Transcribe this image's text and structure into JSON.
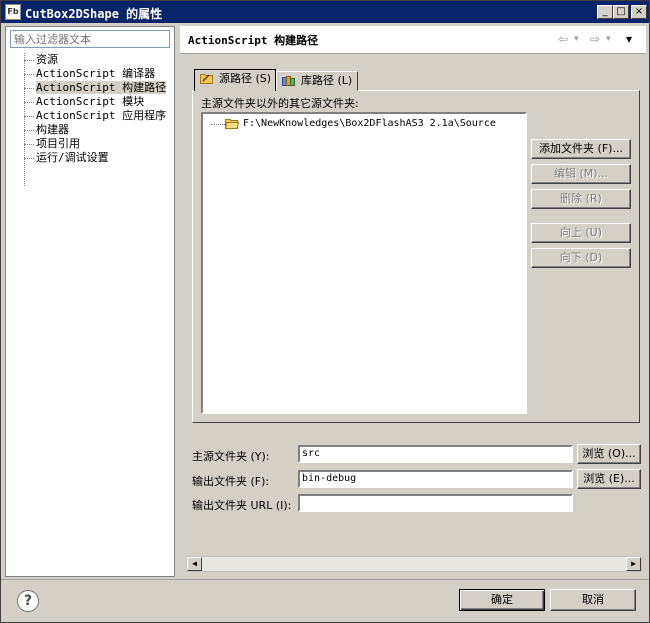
{
  "window": {
    "icon_text": "Fb",
    "title": "CutBox2DShape 的属性",
    "minimize": "_",
    "maximize": "□",
    "close": "×"
  },
  "left": {
    "filter_placeholder": "输入过滤器文本",
    "tree": [
      {
        "label": "资源",
        "selected": false
      },
      {
        "label": "ActionScript 编译器",
        "selected": false
      },
      {
        "label": "ActionScript 构建路径",
        "selected": true
      },
      {
        "label": "ActionScript 模块",
        "selected": false
      },
      {
        "label": "ActionScript 应用程序",
        "selected": false
      },
      {
        "label": "构建器",
        "selected": false
      },
      {
        "label": "项目引用",
        "selected": false
      },
      {
        "label": "运行/调试设置",
        "selected": false
      }
    ]
  },
  "right": {
    "title": "ActionScript 构建路径",
    "nav": {
      "back": "⇦",
      "back_menu": "▾",
      "forward": "⇨",
      "forward_menu": "▾",
      "menu": "▾"
    },
    "tabs": [
      {
        "label": "源路径 (S)",
        "icon": "source-path-icon",
        "active": true
      },
      {
        "label": "库路径 (L)",
        "icon": "library-path-icon",
        "active": false
      }
    ],
    "source_label": "主源文件夹以外的其它源文件夹:",
    "source_items": [
      "F:\\NewKnowledges\\Box2DFlashAS3 2.1a\\Source"
    ],
    "buttons": {
      "add": "添加文件夹 (F)...",
      "edit": "编辑 (M)...",
      "remove": "删除 (R)",
      "up": "向上 (U)",
      "down": "向下 (D)"
    },
    "main_source_label": "主源文件夹 (Y):",
    "main_source_value": "src",
    "output_label": "输出文件夹 (F):",
    "output_value": "bin-debug",
    "output_url_label": "输出文件夹 URL (I):",
    "output_url_value": "",
    "browse1": "浏览 (O)...",
    "browse2": "浏览 (E)...",
    "scroll_left": "◀",
    "scroll_right": "▶"
  },
  "bottom": {
    "help": "?",
    "ok": "确定",
    "cancel": "取消"
  }
}
